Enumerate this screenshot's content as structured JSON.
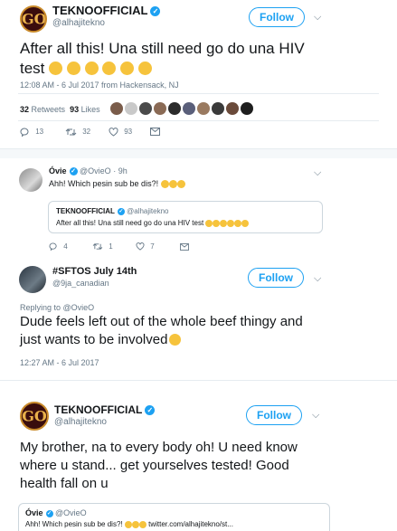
{
  "tweet1": {
    "name": "TEKNOOFFICIAL",
    "handle": "@alhajitekno",
    "follow_label": "Follow",
    "text": "After all this! Una still need go do una HIV test",
    "timestamp": "12:08 AM - 6 Jul 2017 from Hackensack, NJ",
    "retweets_count": "32",
    "retweets_label": "Retweets",
    "likes_count": "93",
    "likes_label": "Likes",
    "reply_count": "13",
    "retweet_count": "32",
    "like_count": "93"
  },
  "reply1": {
    "name": "Óvie",
    "handle": "@OvieO",
    "time": "9h",
    "text": "Ahh! Which pesin sub be dis?!",
    "quote_name": "TEKNOOFFICIAL",
    "quote_handle": "@alhajitekno",
    "quote_text": "After all this! Una still need go do una HIV test",
    "reply_count": "4",
    "retweet_count": "1",
    "like_count": "7"
  },
  "reply2": {
    "name": "#SFTOS July 14th",
    "handle": "@9ja_canadian",
    "follow_label": "Follow",
    "replying_to": "Replying to @OvieO",
    "text": "Dude feels left out of the whole beef thingy and just wants to be involved",
    "timestamp": "12:27 AM - 6 Jul 2017"
  },
  "tweet2": {
    "name": "TEKNOOFFICIAL",
    "handle": "@alhajitekno",
    "follow_label": "Follow",
    "text": "My brother, na to every body oh! U need know where u stand... get yourselves tested! Good health fall on u",
    "quote_name": "Óvie",
    "quote_handle": "@OvieO",
    "quote_text": "Ahh! Which pesin sub be dis?!",
    "quote_link": "twitter.com/alhajitekno/st..."
  },
  "colors": {
    "accent": "#1da1f2",
    "text": "#14171a",
    "secondary": "#657786",
    "divider": "#e6ecf0"
  }
}
